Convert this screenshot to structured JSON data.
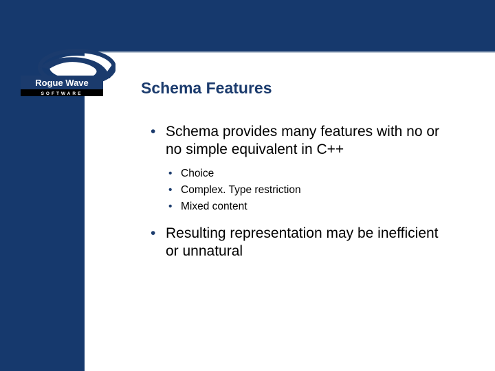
{
  "brand": {
    "name": "Rogue Wave",
    "subtitle": "SOFTWARE"
  },
  "slide": {
    "title": "Schema Features",
    "bullets": [
      {
        "text": "Schema provides many features with no or no simple equivalent in C++",
        "sub": [
          "Choice",
          "Complex. Type restriction",
          "Mixed content"
        ]
      },
      {
        "text": "Resulting representation may be inefficient or unnatural",
        "sub": []
      }
    ]
  }
}
